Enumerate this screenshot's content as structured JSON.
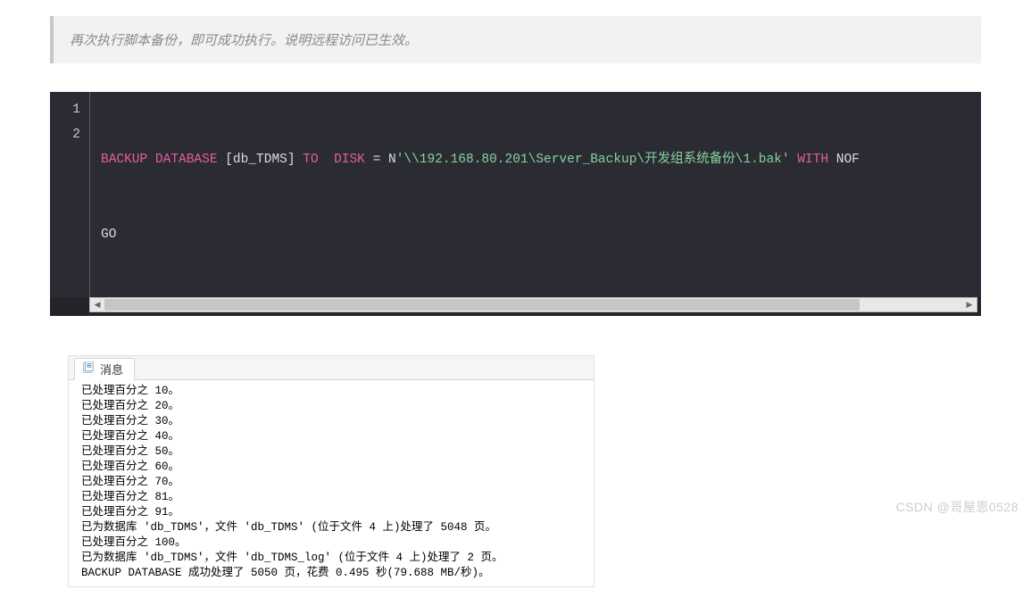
{
  "quote": {
    "text": "再次执行脚本备份，即可成功执行。说明远程访问已生效。"
  },
  "code": {
    "gutter": [
      "1",
      "2"
    ],
    "lines": [
      {
        "parts": [
          {
            "cls": "kw",
            "t": "BACKUP DATABASE"
          },
          {
            "cls": "pl",
            "t": " [db_TDMS] "
          },
          {
            "cls": "kw",
            "t": "TO"
          },
          {
            "cls": "pl",
            "t": "  "
          },
          {
            "cls": "kw",
            "t": "DISK"
          },
          {
            "cls": "pl",
            "t": " = N"
          },
          {
            "cls": "str",
            "t": "'\\\\192.168.80.201\\Server_Backup\\开发组系统备份\\1.bak'"
          },
          {
            "cls": "pl",
            "t": " "
          },
          {
            "cls": "kw",
            "t": "WITH"
          },
          {
            "cls": "pl",
            "t": " NOF"
          }
        ]
      },
      {
        "parts": [
          {
            "cls": "pl",
            "t": "GO"
          }
        ]
      }
    ],
    "scroll_arrows": {
      "left": "◀",
      "right": "▶"
    }
  },
  "messages": {
    "tab_label": "消息",
    "lines": [
      "已处理百分之 10。",
      "已处理百分之 20。",
      "已处理百分之 30。",
      "已处理百分之 40。",
      "已处理百分之 50。",
      "已处理百分之 60。",
      "已处理百分之 70。",
      "已处理百分之 81。",
      "已处理百分之 91。",
      "已为数据库 'db_TDMS'，文件 'db_TDMS' (位于文件 4 上)处理了 5048 页。",
      "已处理百分之 100。",
      "已为数据库 'db_TDMS'，文件 'db_TDMS_log' (位于文件 4 上)处理了 2 页。",
      "BACKUP DATABASE 成功处理了 5050 页，花费 0.495 秒(79.688 MB/秒)。"
    ]
  },
  "watermark": "CSDN @哥屋恩0528"
}
